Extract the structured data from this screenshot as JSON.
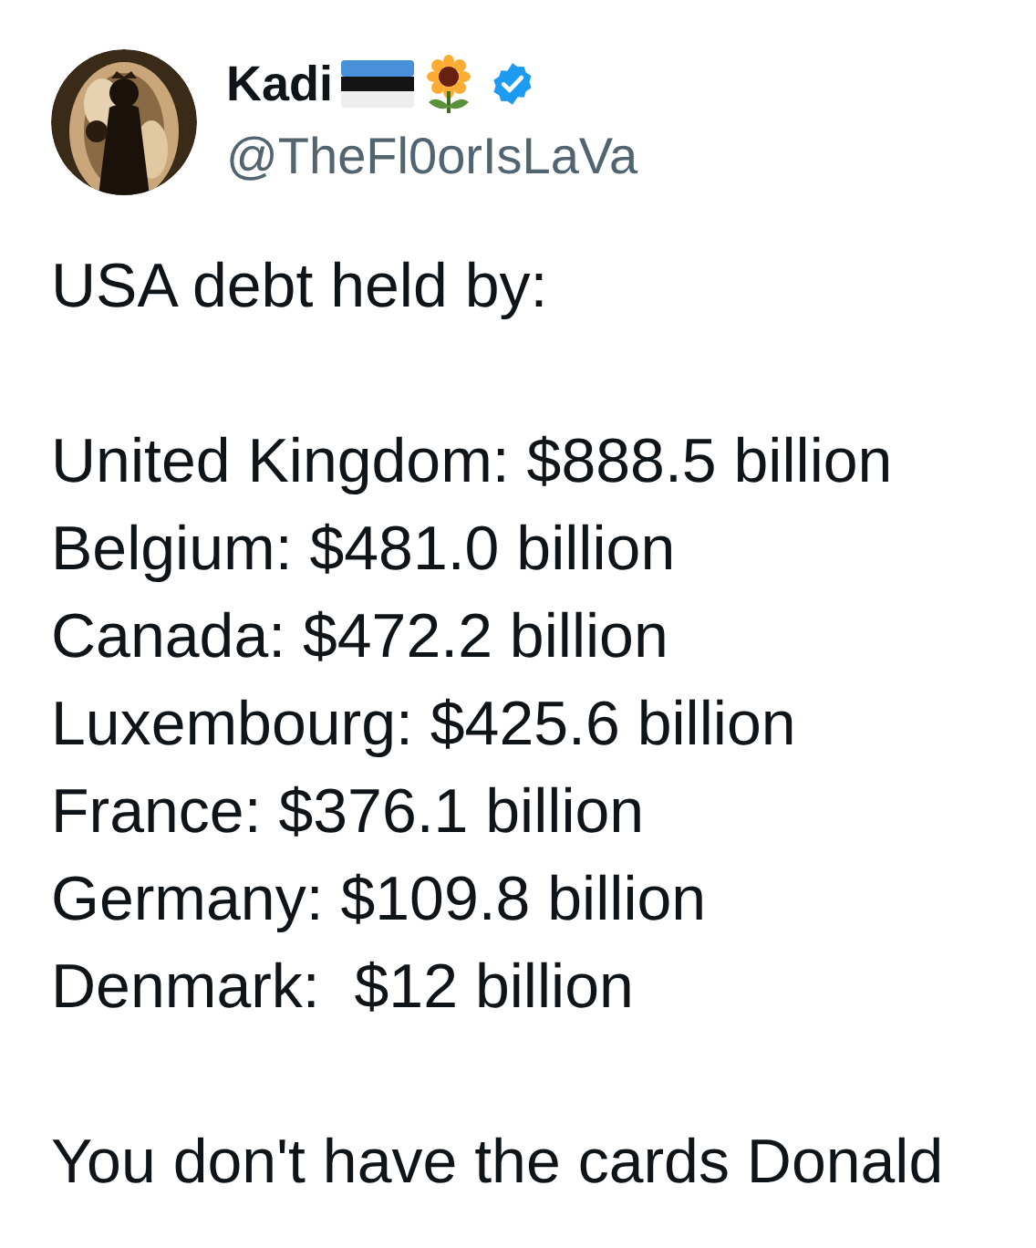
{
  "author": {
    "name": "Kadi",
    "handle": "@TheFl0orIsLaVa",
    "verified": true
  },
  "tweet": {
    "intro": "USA debt held by:",
    "lines": [
      "United Kingdom: $888.5 billion",
      "Belgium: $481.0 billion",
      "Canada: $472.2 billion",
      "Luxembourg: $425.6 billion",
      "France: $376.1 billion",
      "Germany: $109.8 billion",
      "Denmark:  $12 billion"
    ],
    "closing": "You don't have the cards Donald"
  }
}
